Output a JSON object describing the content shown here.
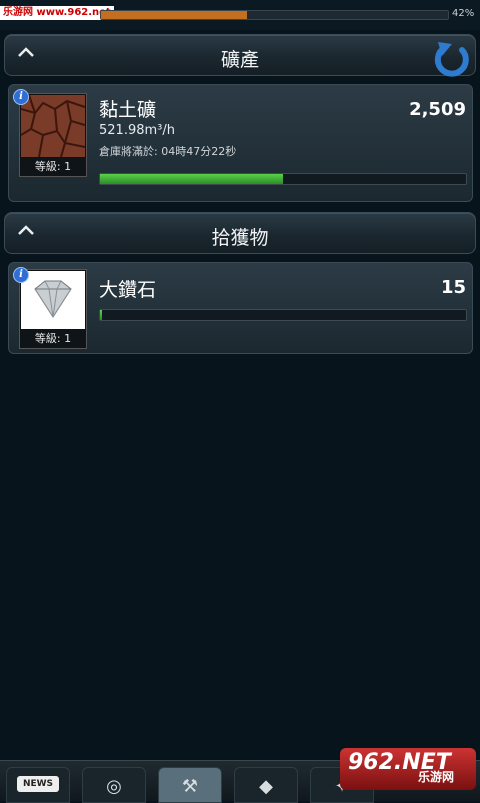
{
  "watermark": {
    "text": "乐游网 www.962.net"
  },
  "top_progress": {
    "percent_label": "42%",
    "fraction": 0.42
  },
  "sections": [
    {
      "title": "礦產"
    },
    {
      "title": "拾獲物"
    }
  ],
  "mine_item": {
    "name": "黏土礦",
    "count": "2,509",
    "level": "等級: 1",
    "rate": "521.98m³/h",
    "storage_full": "倉庫將滿於: 04時47分22秒",
    "progress": 0.5,
    "bar_color": "#4cc23a"
  },
  "loot_item": {
    "name": "大鑽石",
    "count": "15",
    "level": "等級: 1",
    "progress": 0.0
  },
  "icons": {
    "info": "info-icon",
    "refresh": "refresh-icon",
    "collapse": "chevron-up-icon"
  },
  "bottom_nav": {
    "news_label": "NEWS"
  },
  "logo": {
    "big": "962.NET",
    "small": "乐游网"
  }
}
